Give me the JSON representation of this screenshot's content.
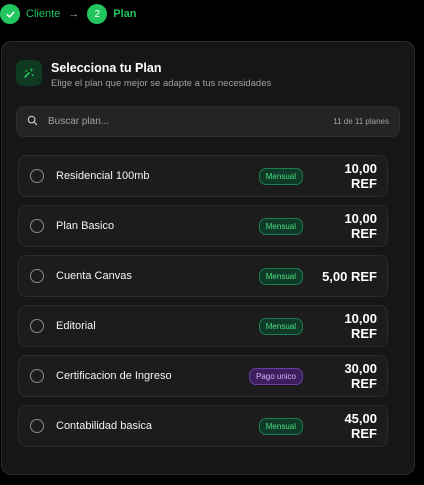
{
  "stepper": {
    "step1_label": "Cliente",
    "step2_number": "2",
    "step2_label": "Plan"
  },
  "header": {
    "title": "Selecciona tu Plan",
    "subtitle": "Elige el plan que mejor se adapte a tus necesidades"
  },
  "search": {
    "placeholder": "Buscar plan...",
    "count": "11 de 11 planes"
  },
  "plans": [
    {
      "name": "Residencial 100mb",
      "badge": "Mensual",
      "badge_color": "green",
      "price": "10,00 REF"
    },
    {
      "name": "Plan Basico",
      "badge": "Mensual",
      "badge_color": "green",
      "price": "10,00 REF"
    },
    {
      "name": "Cuenta Canvas",
      "badge": "Mensual",
      "badge_color": "green",
      "price": "5,00 REF"
    },
    {
      "name": "Editorial",
      "badge": "Mensual",
      "badge_color": "green",
      "price": "10,00 REF"
    },
    {
      "name": "Certificacion de Ingreso",
      "badge": "Pago unico",
      "badge_color": "purple",
      "price": "30,00 REF"
    },
    {
      "name": "Contabilidad basica",
      "badge": "Mensual",
      "badge_color": "green",
      "price": "45,00 REF"
    }
  ],
  "colors": {
    "accent": "#22c55e",
    "badge_green": "#4ade80",
    "badge_purple": "#d8b4fe"
  },
  "icons": {
    "step_done": "check-icon",
    "search": "search-icon",
    "header": "sparkle-icon"
  }
}
